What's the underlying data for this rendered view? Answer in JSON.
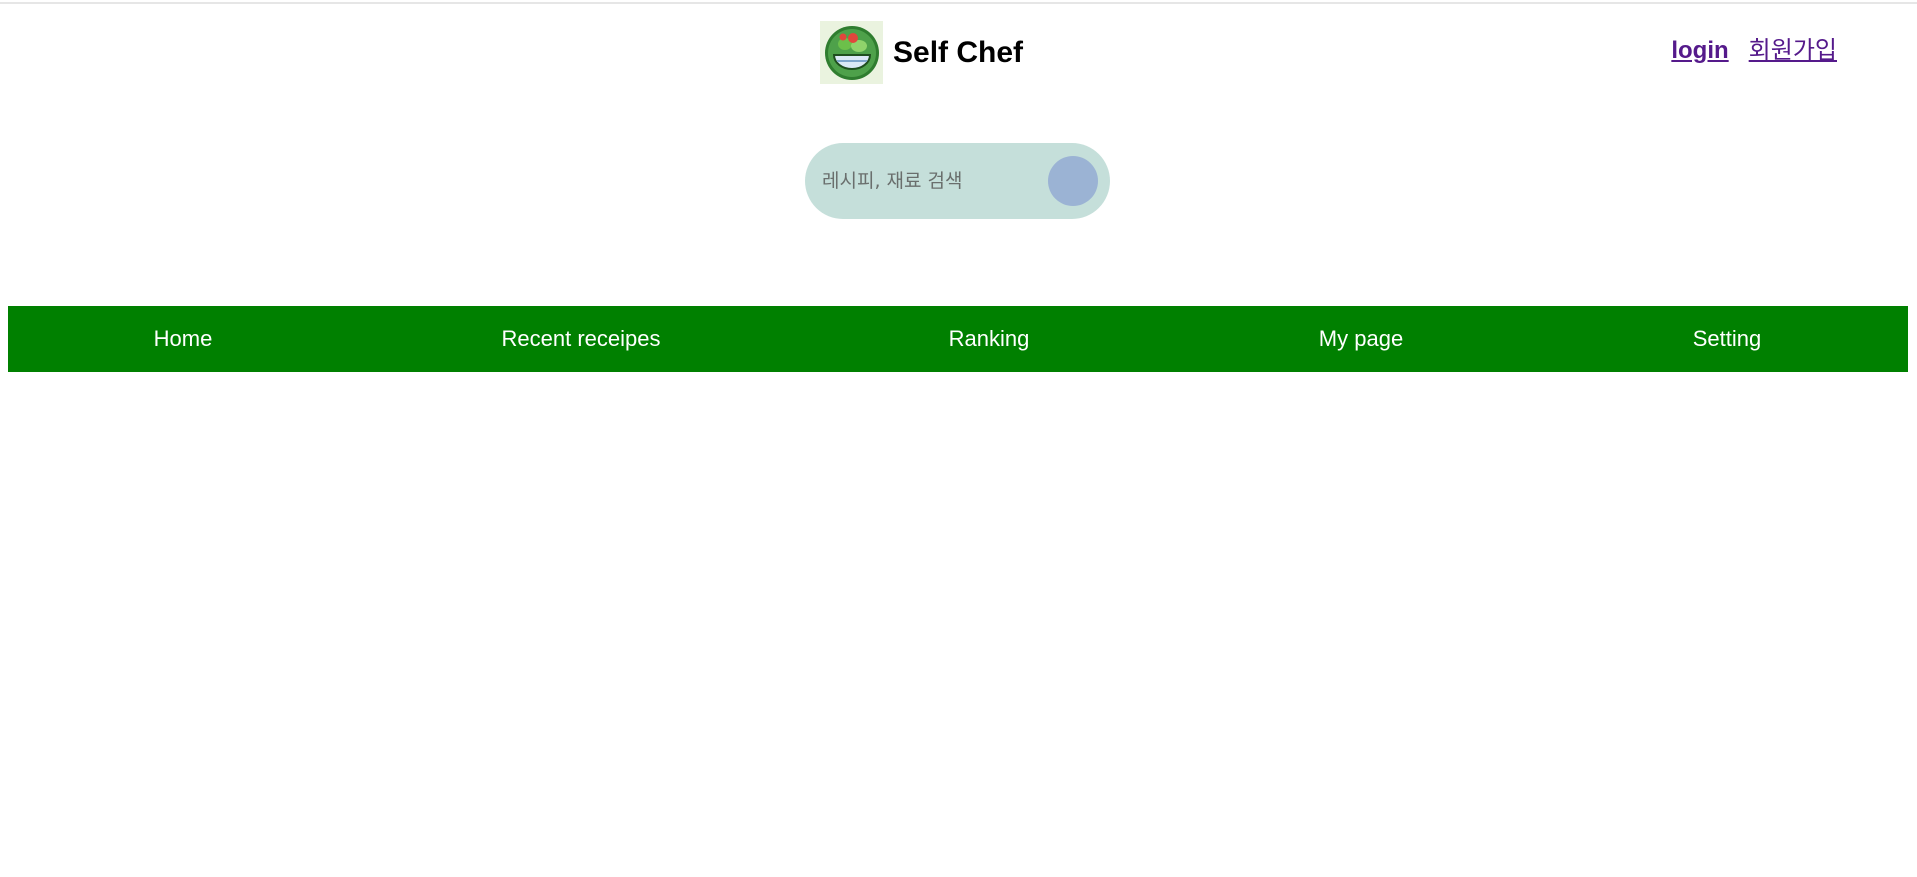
{
  "header": {
    "site_title": "Self Chef",
    "logo_icon": "salad-bowl-icon",
    "auth": {
      "login_label": "login",
      "signup_label": "회원가입"
    }
  },
  "search": {
    "placeholder": "레시피, 재료 검색",
    "value": "",
    "button_color": "#9bb3d4",
    "field_color": "#c5dfda"
  },
  "nav": {
    "background_color": "#008000",
    "items": [
      {
        "label": "Home"
      },
      {
        "label": "Recent receipes"
      },
      {
        "label": "Ranking"
      },
      {
        "label": "My page"
      },
      {
        "label": "Setting"
      }
    ]
  }
}
